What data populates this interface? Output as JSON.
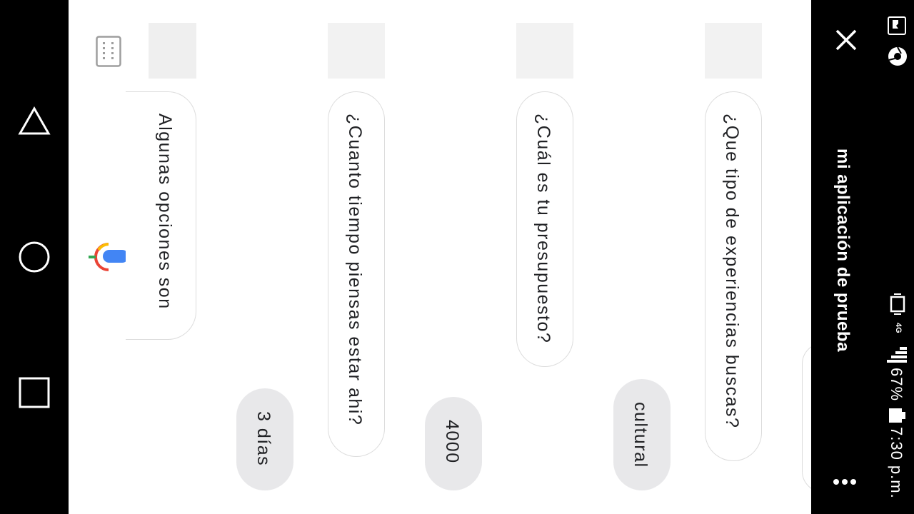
{
  "app": {
    "title": "mi aplicación de prueba"
  },
  "status": {
    "battery": "67%",
    "time": "7:30 p.m.",
    "network": "4G"
  },
  "conversation": {
    "messages": [
      {
        "text": "¿Que tipo de experiencias buscas?",
        "reply": "cultural"
      },
      {
        "text": "¿Cuál es tu presupuesto?",
        "reply": "4000"
      },
      {
        "text": "¿Cuanto tiempo piensas estar ahi?",
        "reply": "3 días"
      },
      {
        "text": "Algunas opciones son"
      }
    ]
  },
  "icons": {
    "nav": [
      "back-triangle-icon",
      "home-circle-icon",
      "recents-square-icon"
    ],
    "toolbar": [
      "close-icon",
      "overflow-menu-icon"
    ],
    "input": [
      "keyboard-icon",
      "google-mic-icon"
    ]
  },
  "colors": {
    "bar": "#000000",
    "chip": "#e8e8ea",
    "bubble_border": "#dcdcdc",
    "mic_blue": "#4285f4",
    "mic_red": "#ea4335",
    "mic_yellow": "#fbbc05",
    "mic_green": "#34a853"
  }
}
